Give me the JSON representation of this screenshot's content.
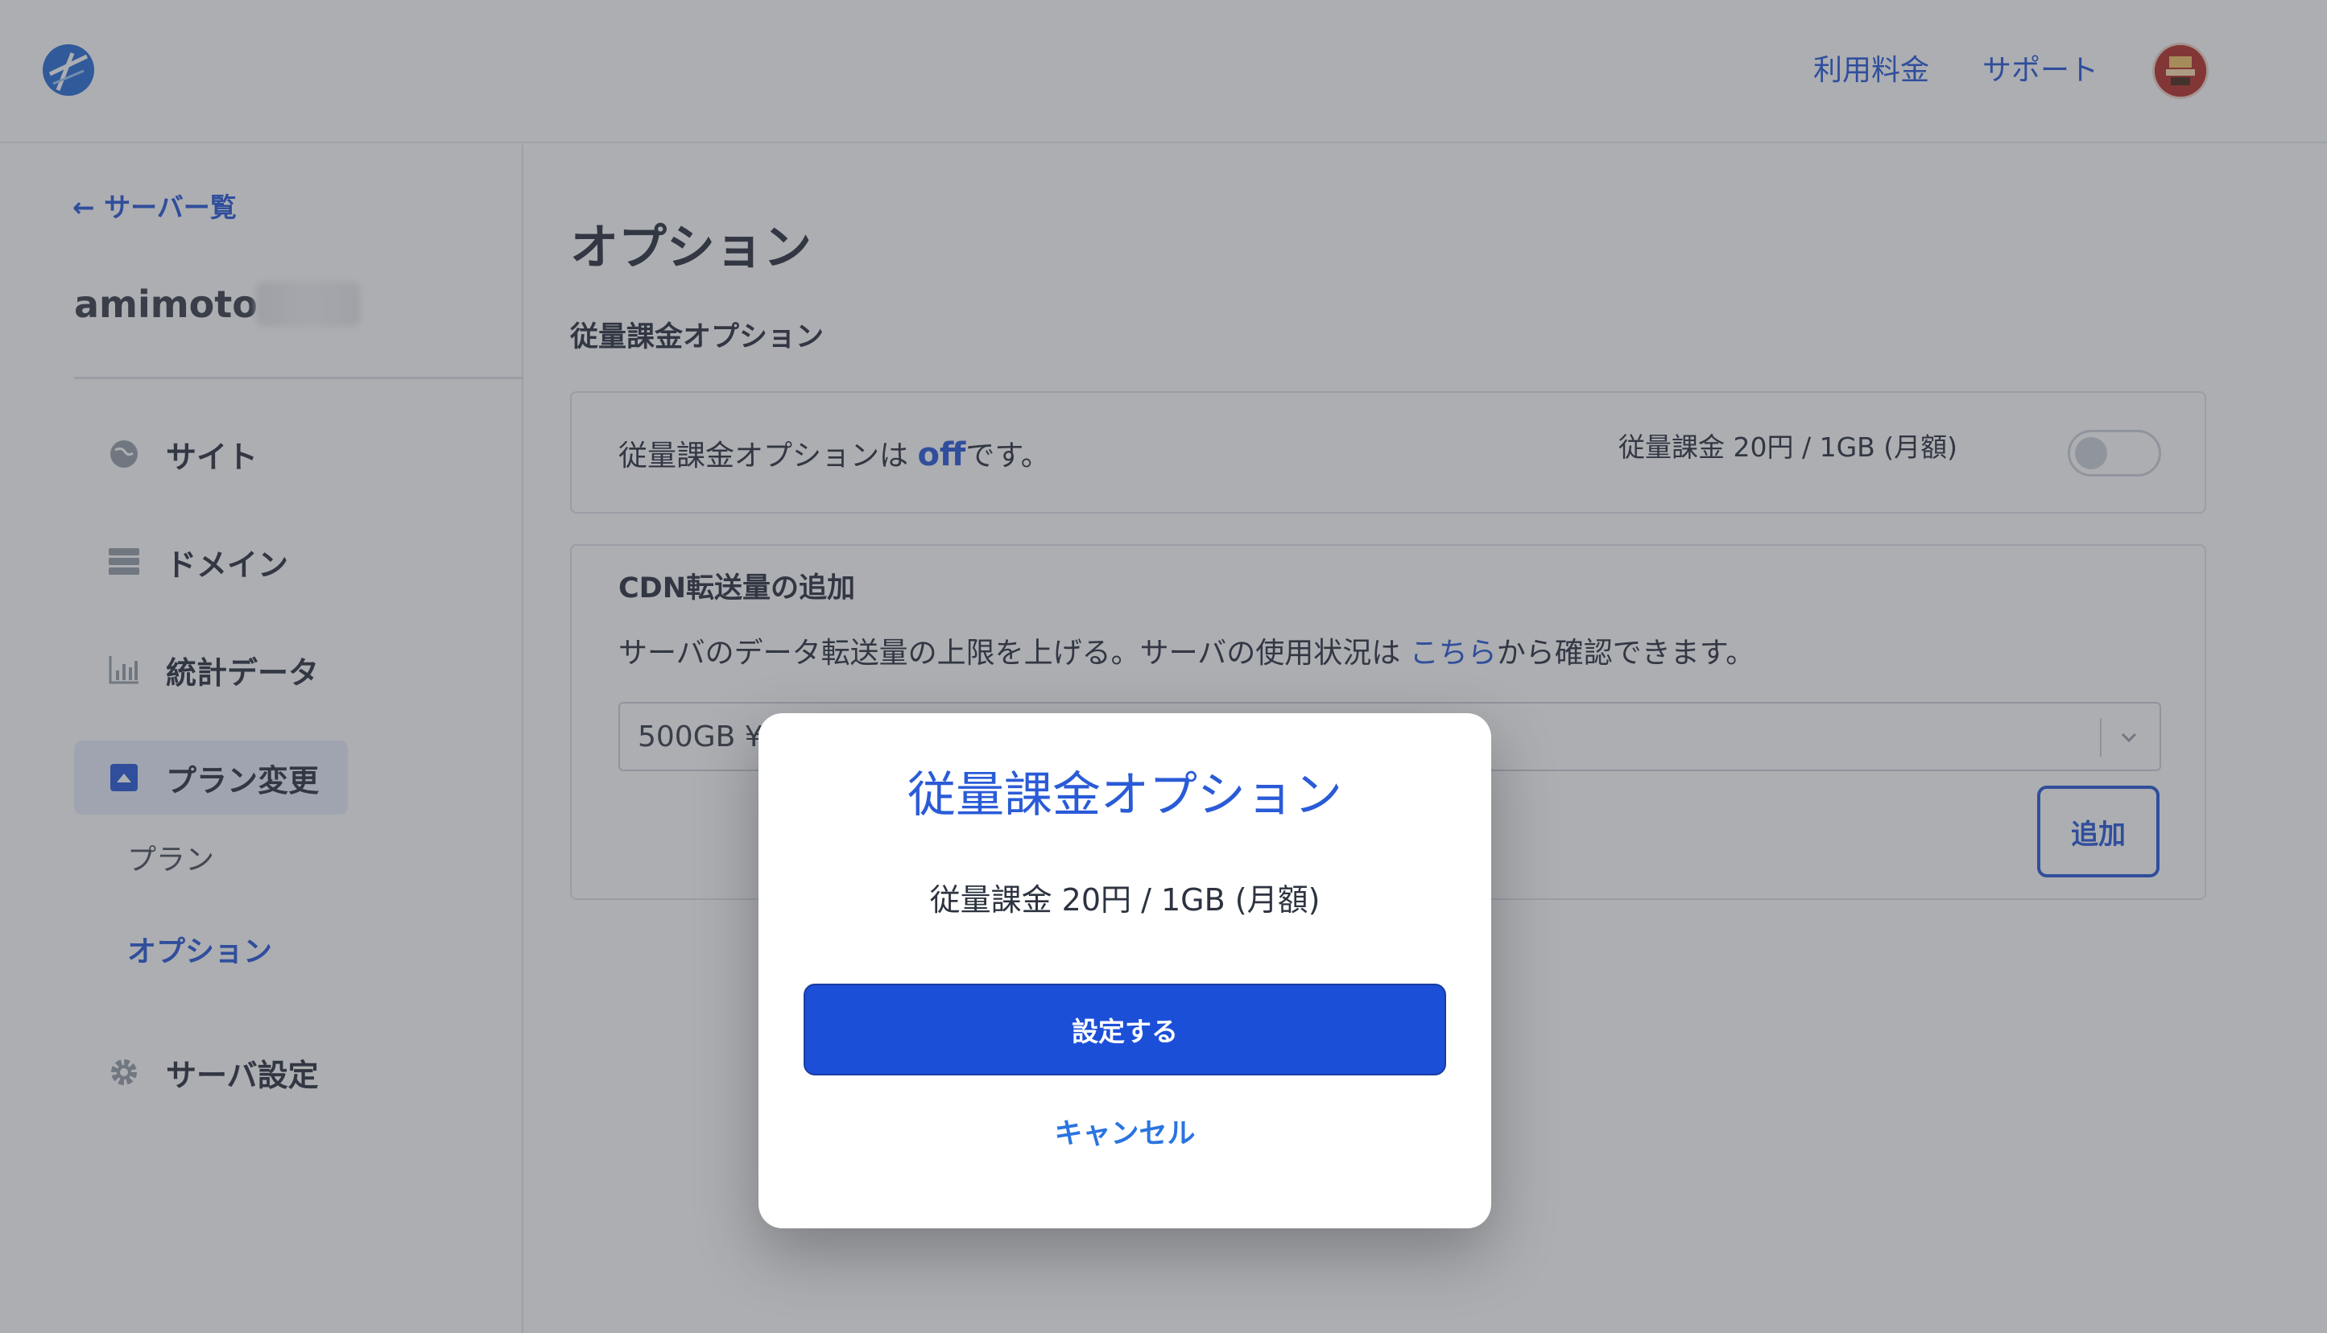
{
  "header": {
    "pricing_label": "利用料金",
    "support_label": "サポート"
  },
  "sidebar": {
    "back_label": "← サーバー覧",
    "server_name": "amimoto.",
    "items": [
      {
        "label": "サイト",
        "icon": "globe-icon"
      },
      {
        "label": "ドメイン",
        "icon": "server-icon"
      },
      {
        "label": "統計データ",
        "icon": "chart-icon"
      },
      {
        "label": "プラン変更",
        "icon": "plan-icon"
      },
      {
        "label": "サーバ設定",
        "icon": "gear-icon"
      }
    ],
    "subitems": [
      {
        "label": "プラン"
      },
      {
        "label": "オプション"
      }
    ]
  },
  "main": {
    "page_title": "オプション",
    "section_title": "従量課金オプション",
    "metered": {
      "status_prefix": "従量課金オプションは ",
      "status_value": "off",
      "status_suffix": "です。",
      "price_label": "従量課金 20円 / 1GB (月額)",
      "toggle_on": false
    },
    "cdn": {
      "title": "CDN転送量の追加",
      "desc_prefix": "サーバのデータ転送量の上限を上げる。サーバの使用状況は ",
      "desc_link": "こちら",
      "desc_suffix": "から確認できます。",
      "select_value": "500GB ¥",
      "add_label": "追加"
    }
  },
  "modal": {
    "title": "従量課金オプション",
    "body": "従量課金 20円 / 1GB (月額)",
    "confirm_label": "設定する",
    "cancel_label": "キャンセル"
  },
  "colors": {
    "accent": "#2a5bd7",
    "primary_button": "#1c4fd8",
    "overlay": "#3a3e48"
  }
}
